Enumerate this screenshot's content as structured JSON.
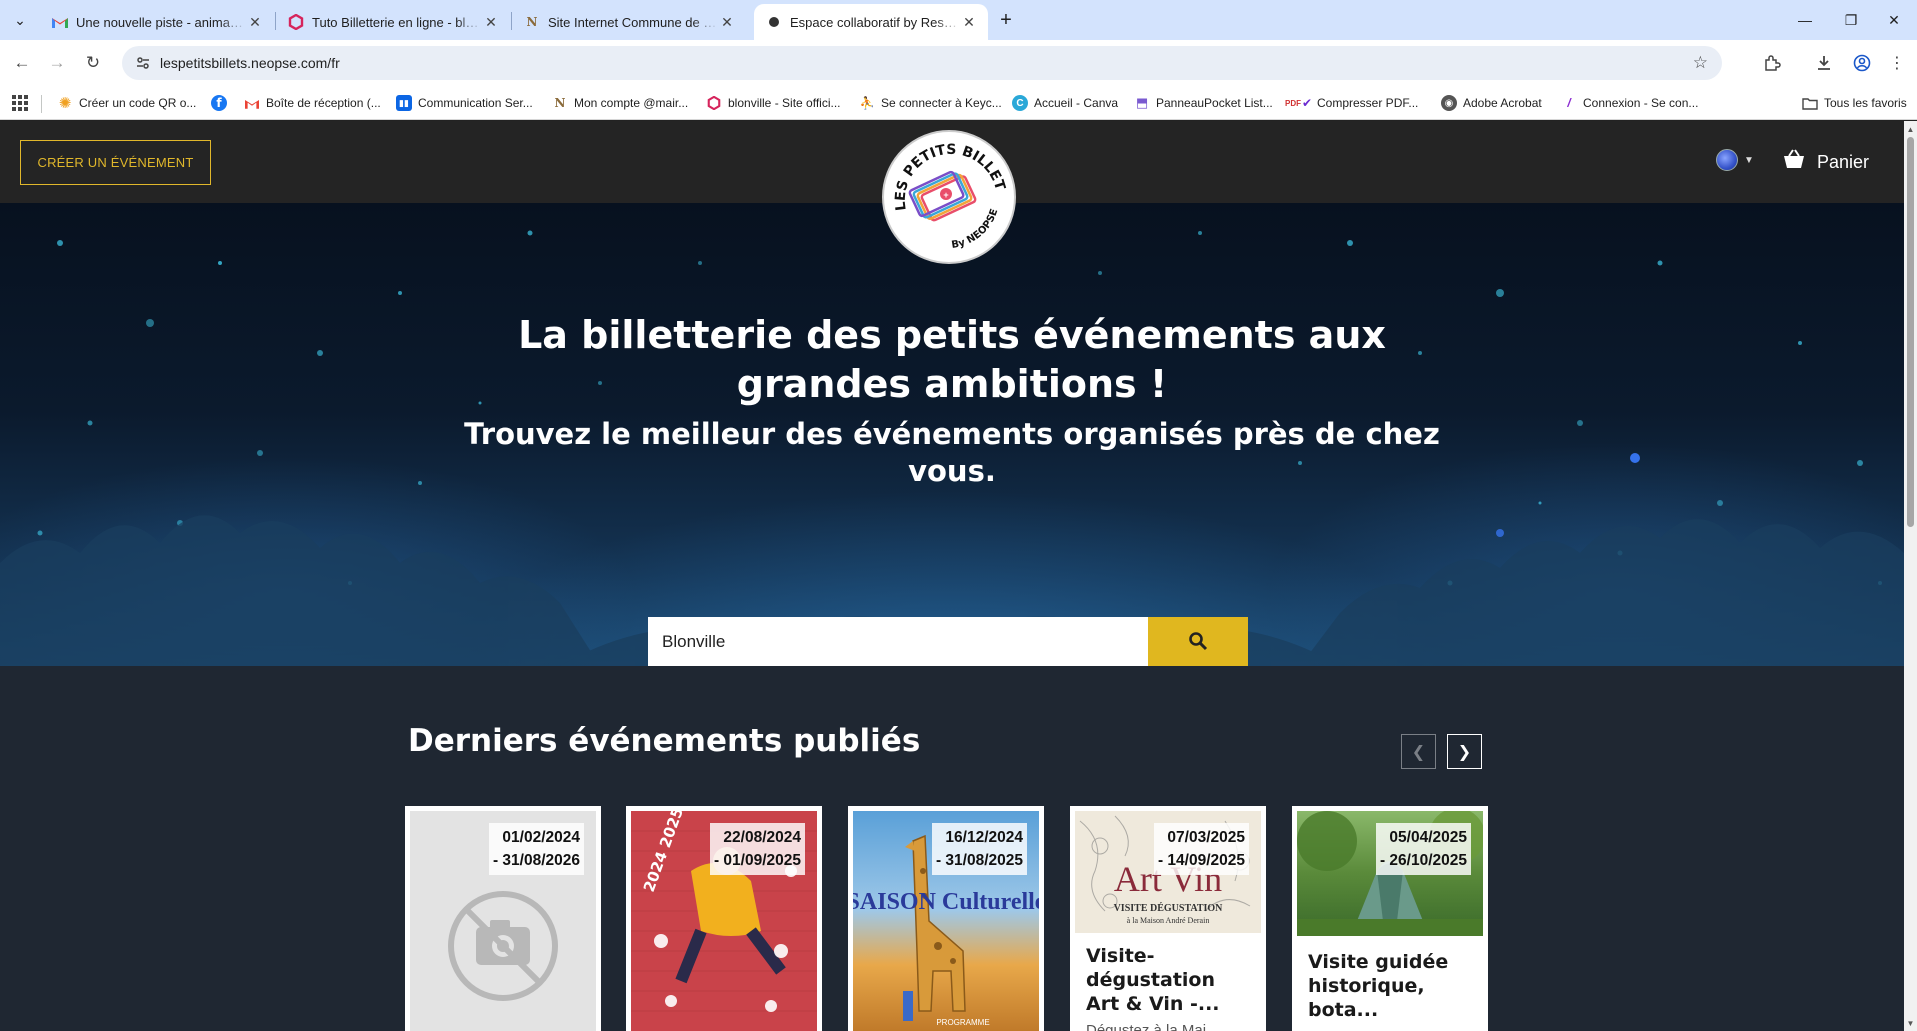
{
  "browser": {
    "tabs": [
      {
        "title": "Une nouvelle piste - animation",
        "favicon": "gmail-icon"
      },
      {
        "title": "Tuto Billetterie en ligne - blonv",
        "favicon": "hexagon-icon"
      },
      {
        "title": "Site Internet Commune de Blon",
        "favicon": "notion-icon"
      },
      {
        "title": "Espace collaboratif by Reseau d",
        "favicon": "dot-icon",
        "active": true
      }
    ],
    "url": "lespetitsbillets.neopse.com/fr",
    "bookmarks": [
      {
        "label": "Créer un code QR o...",
        "icon": "gear-icon"
      },
      {
        "label": "",
        "icon": "facebook-icon"
      },
      {
        "label": "Boîte de réception (...",
        "icon": "gmail-icon"
      },
      {
        "label": "Communication Ser...",
        "icon": "trello-icon"
      },
      {
        "label": "Mon compte @mair...",
        "icon": "notion-icon"
      },
      {
        "label": "blonville - Site offici...",
        "icon": "hexagon-icon"
      },
      {
        "label": "Se connecter à Keyc...",
        "icon": "person-icon"
      },
      {
        "label": "Accueil - Canva",
        "icon": "canva-icon"
      },
      {
        "label": "PanneauPocket List...",
        "icon": "panneau-icon"
      },
      {
        "label": "Compresser PDF...",
        "icon": "pdf-icon"
      },
      {
        "label": "Adobe Acrobat",
        "icon": "acrobat-icon"
      },
      {
        "label": "Connexion - Se con...",
        "icon": "slash-icon"
      }
    ],
    "all_bookmarks": "Tous les favoris"
  },
  "header": {
    "create_event": "CRÉER UN ÉVÉNEMENT",
    "cart": "Panier"
  },
  "logo": {
    "text_top": "LES PETITS BILLETS",
    "text_bottom": "By NEOPSE"
  },
  "hero": {
    "title": "La billetterie des petits événements aux grandes ambitions !",
    "subtitle": "Trouvez le meilleur des événements organisés près de chez vous.",
    "search_value": "Blonville"
  },
  "events": {
    "title": "Derniers événements publiés",
    "cards": [
      {
        "date_start": "01/02/2024",
        "date_end": "- 31/08/2026",
        "title": "",
        "description": ""
      },
      {
        "date_start": "22/08/2024",
        "date_end": "- 01/09/2025",
        "title": "",
        "description": ""
      },
      {
        "date_start": "16/12/2024",
        "date_end": "- 31/08/2025",
        "title": "",
        "description": ""
      },
      {
        "date_start": "07/03/2025",
        "date_end": "- 14/09/2025",
        "title": "Visite-dégustation Art & Vin -...",
        "description": "Dégustez à la Mai..."
      },
      {
        "date_start": "05/04/2025",
        "date_end": "- 26/10/2025",
        "title": "Visite guidée historique, bota...",
        "description": ""
      }
    ],
    "poster_texts": {
      "saison_culturelle": "SAISON Culturelle",
      "years": "2024 2025",
      "programme": "PROGRAMME",
      "art_vin": "Art Vin",
      "visite_degustation": "VISITE DÉGUSTATION",
      "maison": "à la Maison André Derain"
    }
  }
}
